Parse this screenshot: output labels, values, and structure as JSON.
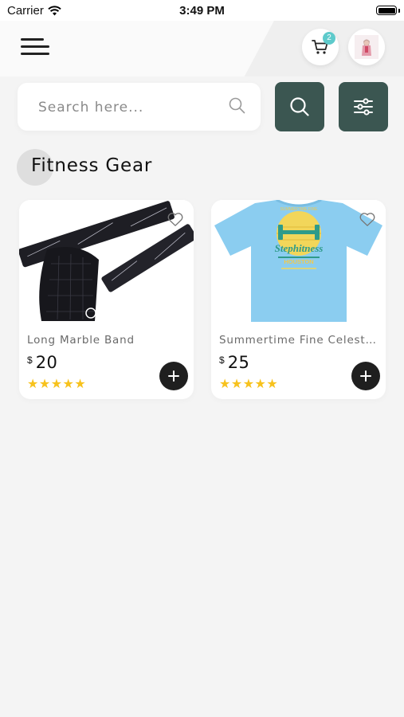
{
  "status_bar": {
    "carrier": "Carrier",
    "time": "3:49 PM"
  },
  "header": {
    "cart_count": "2"
  },
  "search": {
    "placeholder": "Search here..."
  },
  "section": {
    "title": "Fitness Gear"
  },
  "products": [
    {
      "name": "Long Marble Band",
      "currency": "$",
      "price": "20",
      "rating": 5,
      "stars": "★★★★★",
      "image": "black marble-pattern resistance band with mesh bag"
    },
    {
      "name": "Summertime Fine Celeste T...",
      "currency": "$",
      "price": "25",
      "rating": 5,
      "stars": "★★★★★",
      "image": "light blue t-shirt with yellow dumbbell graphic"
    }
  ],
  "colors": {
    "accent": "#3b5651",
    "badge": "#5ecacb",
    "star": "#f7c21d",
    "background": "#f4f4f4"
  },
  "icons": [
    "wifi-icon",
    "battery-icon",
    "menu-icon",
    "cart-icon",
    "avatar",
    "search-icon",
    "filter-icon",
    "heart-icon",
    "plus-icon"
  ]
}
